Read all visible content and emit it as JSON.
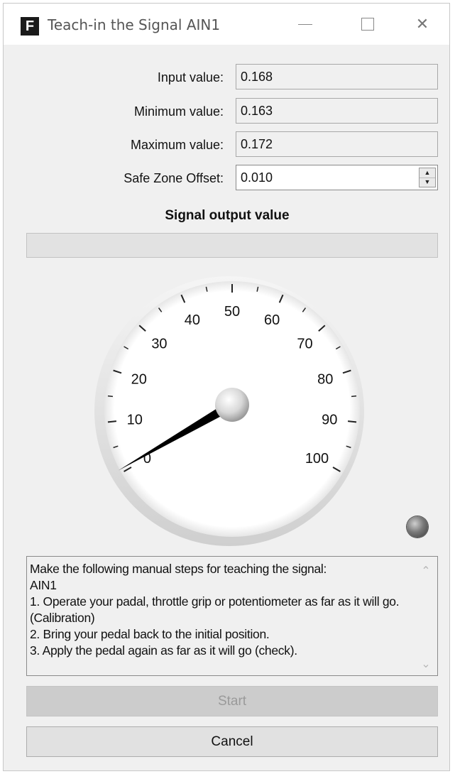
{
  "window": {
    "title": "Teach-in the Signal AIN1",
    "app_icon_letter": "F",
    "minimize_glyph": "—",
    "maximize_glyph": "☐",
    "close_glyph": "✕"
  },
  "fields": {
    "input_label": "Input value:",
    "input_value": "0.168",
    "min_label": "Minimum value:",
    "min_value": "0.163",
    "max_label": "Maximum value:",
    "max_value": "0.172",
    "offset_label": "Safe Zone Offset:",
    "offset_value": "0.010"
  },
  "signal_output": {
    "title": "Signal output value",
    "progress_fraction": 0
  },
  "gauge": {
    "labels": [
      "0",
      "10",
      "20",
      "30",
      "40",
      "50",
      "60",
      "70",
      "80",
      "90",
      "100"
    ],
    "min": 0,
    "max": 100,
    "needle_value": 0,
    "needle_color": "#000000"
  },
  "status_led": {
    "color": "#6e6e6e"
  },
  "instructions": {
    "text": "Make the following manual steps for teaching the signal:\nAIN1\n1. Operate your padal, throttle grip or potentiometer as far as it will go. (Calibration)\n2. Bring your pedal back to the initial position.\n3. Apply the pedal again as far as it will go (check).",
    "scroll_up_glyph": "⌃",
    "scroll_down_glyph": "⌄"
  },
  "buttons": {
    "start_label": "Start",
    "cancel_label": "Cancel"
  }
}
